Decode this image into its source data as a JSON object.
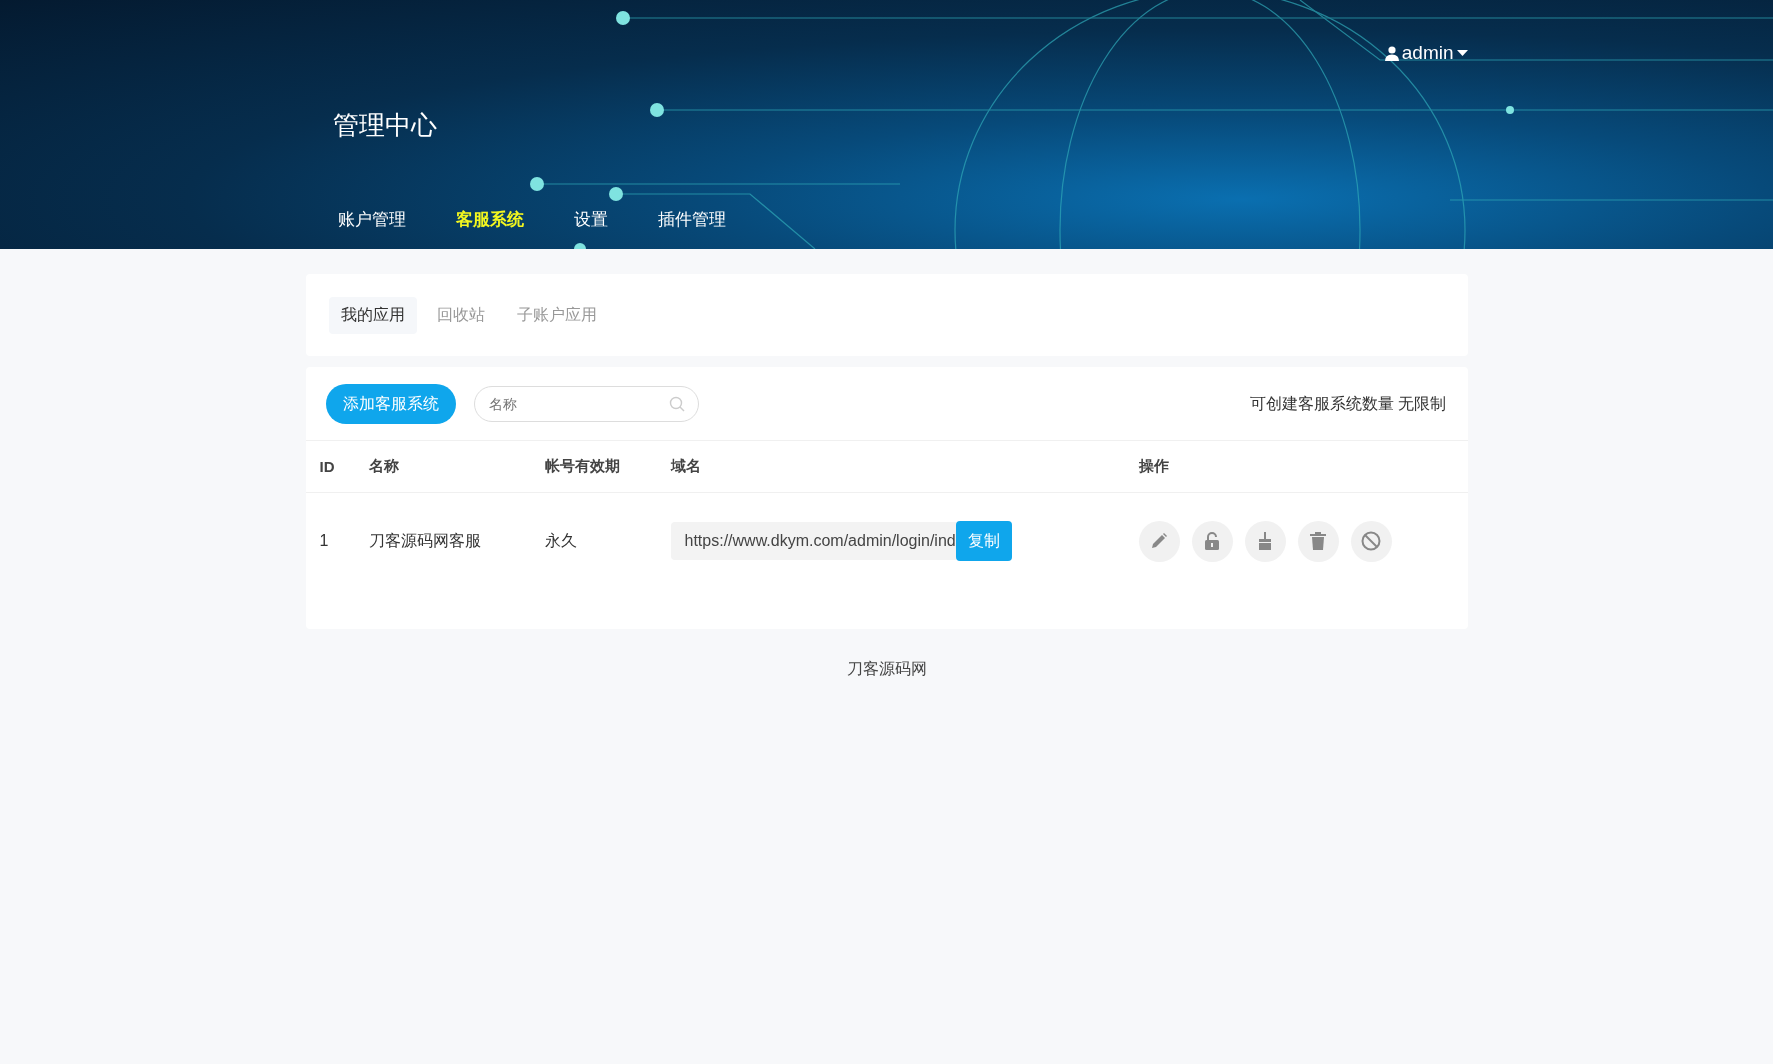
{
  "header": {
    "title": "管理中心",
    "user": {
      "name": "admin"
    },
    "nav": [
      {
        "label": "账户管理",
        "selected": false
      },
      {
        "label": "客服系统",
        "selected": true
      },
      {
        "label": "设置",
        "selected": false
      },
      {
        "label": "插件管理",
        "selected": false
      }
    ]
  },
  "tabs": [
    {
      "label": "我的应用",
      "selected": true
    },
    {
      "label": "回收站",
      "selected": false
    },
    {
      "label": "子账户应用",
      "selected": false
    }
  ],
  "toolbar": {
    "add_button": "添加客服系统",
    "search": {
      "placeholder": "名称"
    },
    "quota_label": "可创建客服系统数量 无限制"
  },
  "table": {
    "columns": [
      "ID",
      "名称",
      "帐号有效期",
      "域名",
      "操作"
    ],
    "rows": [
      {
        "id": "1",
        "name": "刀客源码网客服",
        "validity": "永久",
        "domain": "https://www.dkym.com/admin/login/ind",
        "copy_button": "复制",
        "actions": [
          {
            "kind": "edit"
          },
          {
            "kind": "unlock"
          },
          {
            "kind": "clean"
          },
          {
            "kind": "delete"
          },
          {
            "kind": "disable"
          }
        ]
      }
    ]
  },
  "footer": "刀客源码网"
}
